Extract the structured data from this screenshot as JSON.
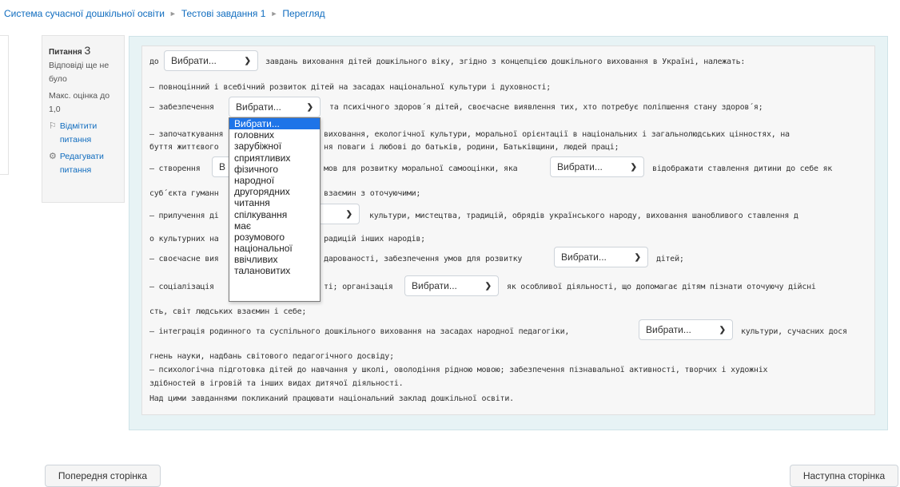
{
  "breadcrumb": {
    "items": [
      "Система сучасної дошкільної освіти",
      "Тестові завдання 1",
      "Перегляд"
    ],
    "separator": "►"
  },
  "question_info": {
    "label": "Питання",
    "number": "3",
    "status_1": "Відповіді ще не",
    "status_2": "було",
    "max_1": "Макс. оцінка до",
    "max_2": "1,0",
    "flag_1": "Відмітити",
    "flag_2": "питання",
    "edit_1": "Редагувати",
    "edit_2": "питання"
  },
  "select_placeholder": "Вибрати...",
  "lines": [
    {
      "pre": "до",
      "post": "завдань виховання дітей дошкільного віку, згідно з концепцією дошкільного виховання в Україні, належать:"
    },
    {
      "text": "– повноцінний і всебічний розвиток дітей на засадах національної культури і духовності;"
    },
    {
      "pre": "– забезпечення",
      "post": "та психічного здоров´я дітей, своєчасне виявлення тих, хто потребує поліпшення стану здоров´я;"
    },
    {
      "text1": "– започаткування",
      "text1b": "виховання, екологічної культури, моральної орієнтації в національних і загальнолюдських цінностях, на"
    },
    {
      "text": "буття життєвого",
      "textb": "ня поваги і любові до батьків, родини, Батьківщини, людей праці;"
    },
    {
      "pre": "– створення",
      "mid": "мов для розвитку моральної самооцінки, яка",
      "post": "відображати ставлення дитини до себе як"
    },
    {
      "text": "суб´єкта гуманн",
      "textb": "взаємин з оточуючими;"
    },
    {
      "pre": "– прилучення ді",
      "post": "культури, мистецтва, традицій, обрядів українського народу, виховання шанобливого ставлення д"
    },
    {
      "text": "о культурних на",
      "textb": "радицій інших народів;"
    },
    {
      "pre": "– своєчасне вия",
      "mid": "дарованості, забезпечення умов для розвитку",
      "post": "дітей;"
    },
    {
      "pre": "– соціалізація",
      "mid": "ті; організація",
      "post": "як особливої діяльності, що допомагає дітям пізнати оточуючу дійсні"
    },
    {
      "text": "сть, світ людських взаємин і себе;"
    },
    {
      "pre": "– інтеграція родинного та суспільного дошкільного виховання на засадах народної педагогіки,",
      "post": "культури, сучасних дося"
    },
    {
      "text": "гнень науки, надбань світового педагогічного досвіду;"
    },
    {
      "text": "– психологічна підготовка дітей до навчання у школі, оволодіння рідною мовою; забезпечення пізнавальної активності, творчих і художніх"
    },
    {
      "text": "здібностей в ігровій та інших видах дитячої діяльності."
    },
    {
      "text": "Над цими завданнями покликаний працювати національний заклад дошкільної освіти."
    }
  ],
  "dropdown_options": [
    "Вибрати...",
    "головних",
    "зарубіжної",
    "сприятливих",
    "фізичного",
    "народної",
    "другорядних",
    "читання",
    "спілкування",
    "має",
    "розумового",
    "національної",
    "ввічливих",
    "талановитих"
  ],
  "nav": {
    "prev": "Попередня сторінка",
    "next": "Наступна сторінка"
  }
}
